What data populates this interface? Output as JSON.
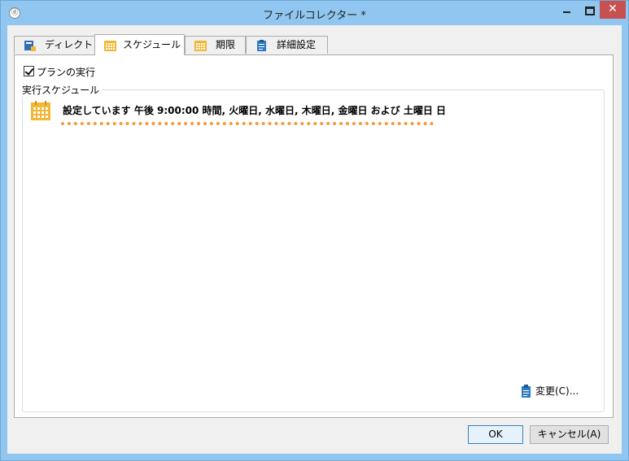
{
  "window": {
    "title": "ファイルコレクター *",
    "close_glyph": "✕"
  },
  "tabs": [
    {
      "label": "ディレクトリ",
      "icon": "directory-icon",
      "active": false
    },
    {
      "label": "スケジュール",
      "icon": "calendar-icon",
      "active": true
    },
    {
      "label": "期限",
      "icon": "calendar-icon",
      "active": false
    },
    {
      "label": "詳細設定",
      "icon": "clipboard-icon",
      "active": false
    }
  ],
  "schedule": {
    "enable_label": "プランの実行",
    "enabled": true,
    "group_label": "実行スケジュール",
    "description": "設定しています 午後 9:00:00 時間, 火曜日, 水曜日, 木曜日, 金曜日 および 土曜日 日",
    "change_label": "変更(C)..."
  },
  "buttons": {
    "ok": "OK",
    "cancel": "キャンセル(A)"
  },
  "colors": {
    "title_bar": "#90c6ef",
    "close_button": "#c75050",
    "calendar_icon": "#f2b735",
    "dotted_underline": "#f39a3c",
    "clipboard_icon": "#2f7bc1"
  }
}
